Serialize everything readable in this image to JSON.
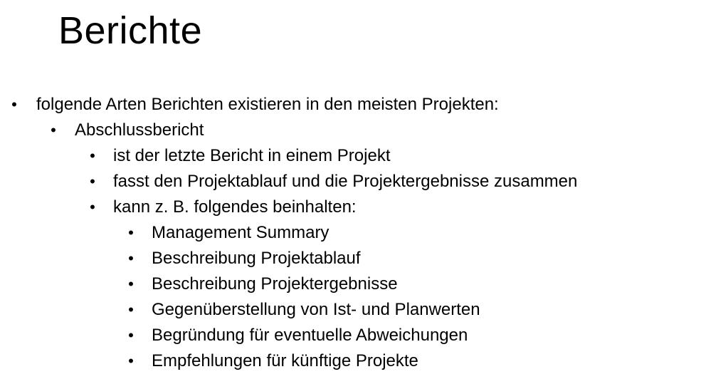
{
  "slide": {
    "title": "Berichte",
    "bullet_glyph": "•",
    "bullets": [
      {
        "level": 1,
        "text": "folgende Arten Berichten existieren in den meisten Projekten:"
      },
      {
        "level": 2,
        "text": "Abschlussbericht"
      },
      {
        "level": 3,
        "text": "ist der letzte Bericht in einem Projekt"
      },
      {
        "level": 3,
        "text": "fasst den Projektablauf und die Projektergebnisse zusammen"
      },
      {
        "level": 3,
        "text": "kann z. B. folgendes beinhalten:"
      },
      {
        "level": 4,
        "text": "Management Summary"
      },
      {
        "level": 4,
        "text": "Beschreibung Projektablauf"
      },
      {
        "level": 4,
        "text": "Beschreibung Projektergebnisse"
      },
      {
        "level": 4,
        "text": "Gegenüberstellung von Ist- und Planwerten"
      },
      {
        "level": 4,
        "text": "Begründung für eventuelle Abweichungen"
      },
      {
        "level": 4,
        "text": "Empfehlungen für künftige Projekte"
      }
    ]
  }
}
